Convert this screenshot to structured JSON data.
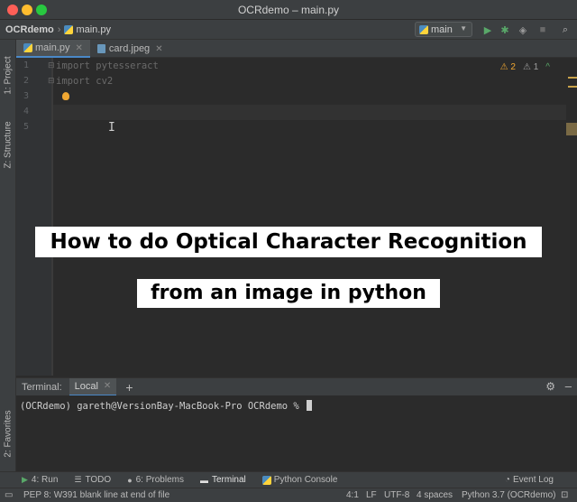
{
  "window": {
    "title": "OCRdemo – main.py"
  },
  "navbar": {
    "project": "OCRdemo",
    "file": "main.py",
    "run_config": "main"
  },
  "left_strip": {
    "project": "1: Project",
    "structure": "Z: Structure",
    "favorites": "2: Favorites"
  },
  "tabs": [
    {
      "label": "main.py",
      "active": true
    },
    {
      "label": "card.jpeg",
      "active": false
    }
  ],
  "editor": {
    "lines": [
      {
        "num": "1",
        "text": "import pytesseract"
      },
      {
        "num": "2",
        "text": "import cv2"
      },
      {
        "num": "3",
        "text": ""
      },
      {
        "num": "4",
        "text": ""
      },
      {
        "num": "5",
        "text": ""
      }
    ],
    "warnings": "2",
    "weak_warnings": "1",
    "caret_glyph": "I"
  },
  "overlay": {
    "line1": "How to do Optical Character Recognition",
    "line2": "from an image in python"
  },
  "terminal": {
    "label": "Terminal:",
    "tab": "Local",
    "prompt": "(OCRdemo) gareth@VersionBay-MacBook-Pro OCRdemo % "
  },
  "tool_windows": {
    "run": "4: Run",
    "todo": "TODO",
    "problems": "6: Problems",
    "terminal": "Terminal",
    "python_console": "Python Console",
    "event_log": "Event Log"
  },
  "status": {
    "message": "PEP 8: W391 blank line at end of file",
    "position": "4:1",
    "line_sep": "LF",
    "encoding": "UTF-8",
    "indent": "4 spaces",
    "interpreter": "Python 3.7 (OCRdemo)"
  },
  "colors": {
    "accent": "#4a88c7",
    "warning": "#f0a732",
    "run_green": "#59a869"
  }
}
